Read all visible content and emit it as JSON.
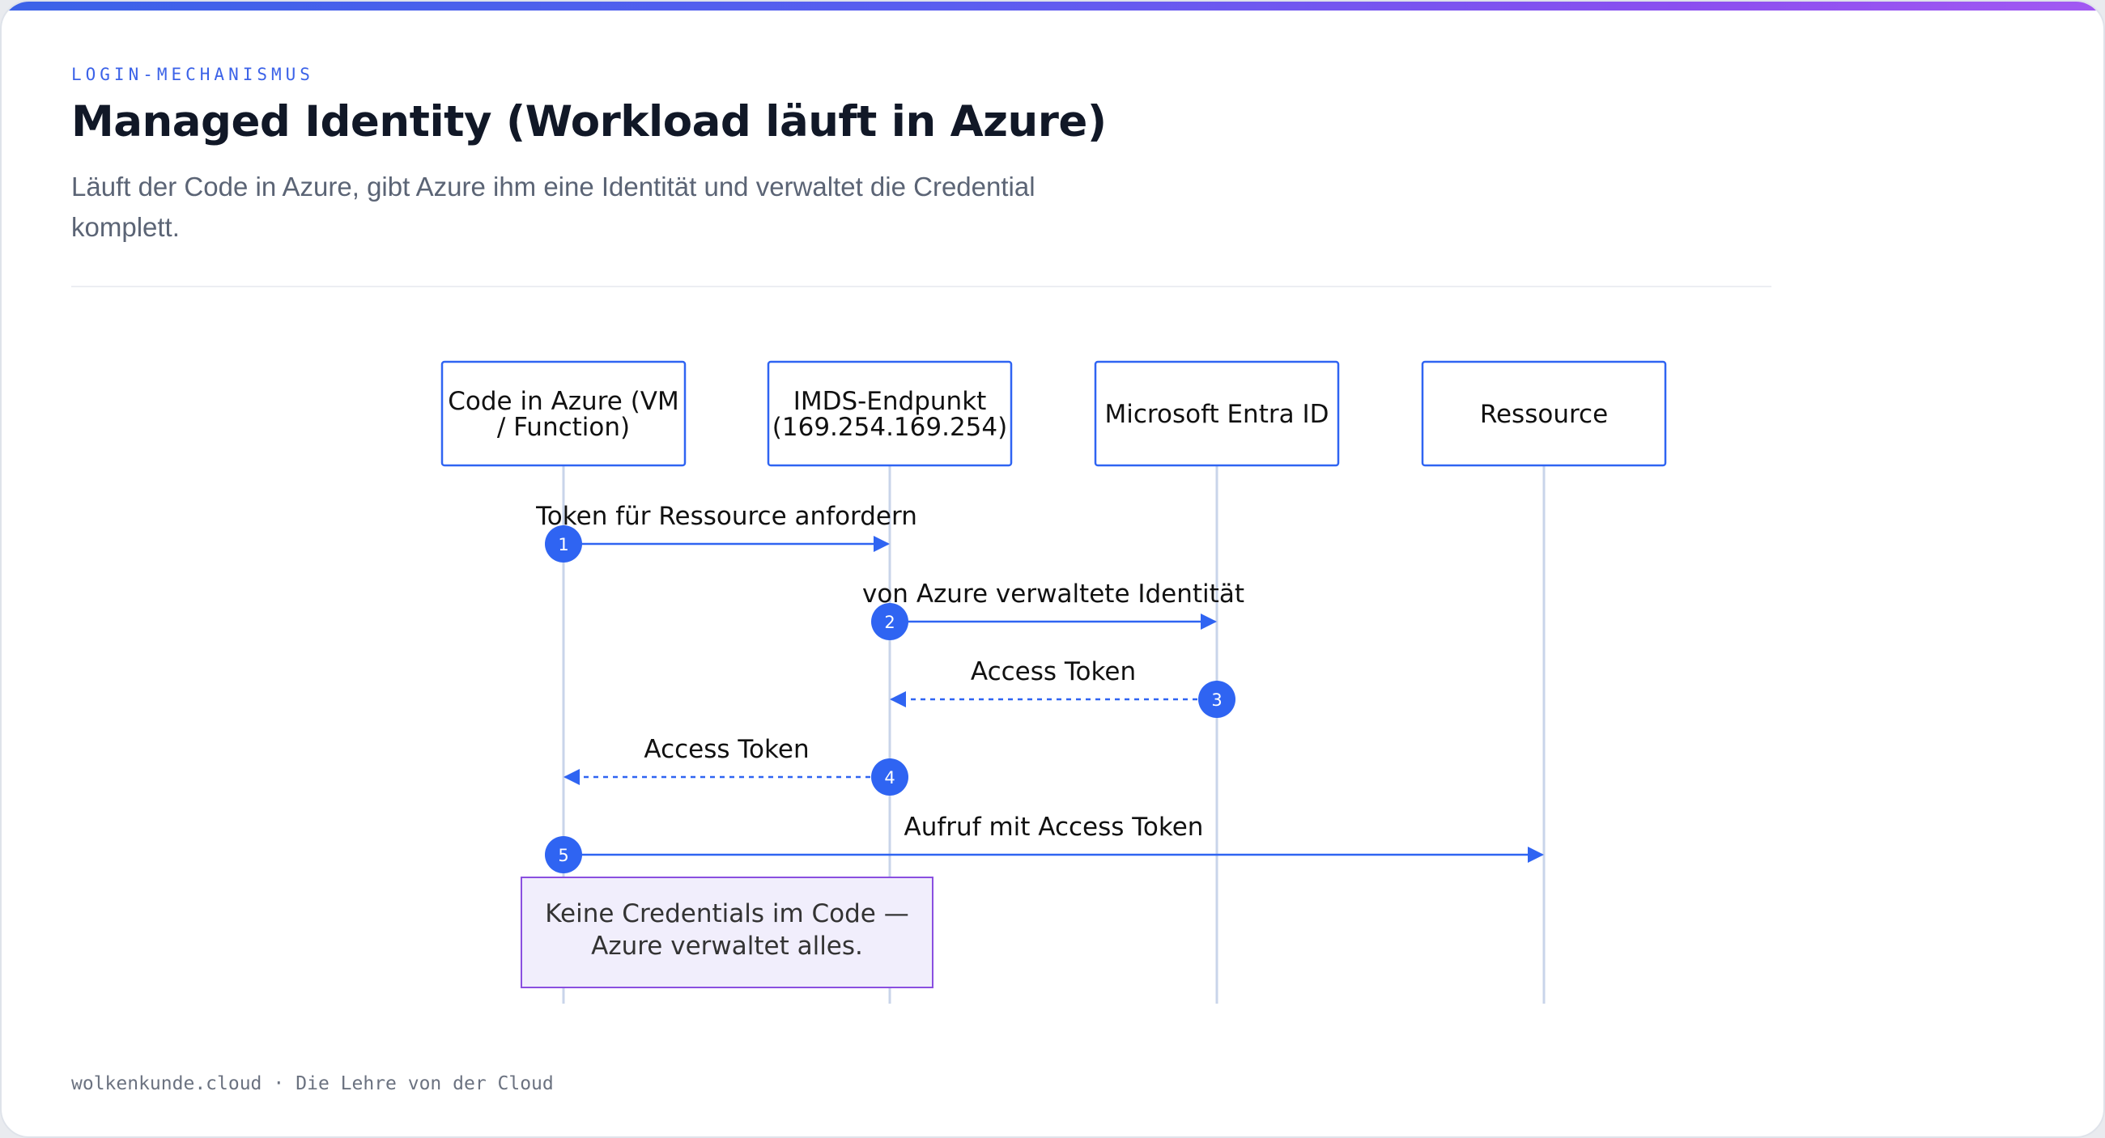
{
  "header": {
    "eyebrow": "LOGIN-MECHANISMUS",
    "title": "Managed Identity (Workload läuft in Azure)",
    "subtitle": "Läuft der Code in Azure, gibt Azure ihm eine Identität und verwaltet die Credential komplett."
  },
  "diagram": {
    "participants": [
      {
        "id": "code",
        "lines": [
          "Code in Azure (VM",
          "/ Function)"
        ]
      },
      {
        "id": "imds",
        "lines": [
          "IMDS-Endpunkt",
          "(169.254.169.254)"
        ]
      },
      {
        "id": "entra",
        "lines": [
          "Microsoft Entra ID"
        ]
      },
      {
        "id": "resource",
        "lines": [
          "Ressource"
        ]
      }
    ],
    "messages": [
      {
        "number": "1",
        "from": "code",
        "to": "imds",
        "label": "Token für Ressource anfordern",
        "style": "solid"
      },
      {
        "number": "2",
        "from": "imds",
        "to": "entra",
        "label": "von Azure verwaltete Identität",
        "style": "solid"
      },
      {
        "number": "3",
        "from": "entra",
        "to": "imds",
        "label": "Access Token",
        "style": "dashed"
      },
      {
        "number": "4",
        "from": "imds",
        "to": "code",
        "label": "Access Token",
        "style": "dashed"
      },
      {
        "number": "5",
        "from": "code",
        "to": "resource",
        "label": "Aufruf mit Access Token",
        "style": "solid"
      }
    ],
    "note": {
      "lines": [
        "Keine Credentials im Code —",
        "Azure verwaltet alles."
      ]
    }
  },
  "colors": {
    "accent": "#2f64f2",
    "box_border": "#2f64f2",
    "lifeline": "#c9d4ea",
    "note_fill": "#f1eefc",
    "note_border": "#8a4fe0",
    "text": "#111111"
  },
  "footer": {
    "site": "wolkenkunde.cloud",
    "separator": "·",
    "tagline": "Die Lehre von der Cloud"
  }
}
